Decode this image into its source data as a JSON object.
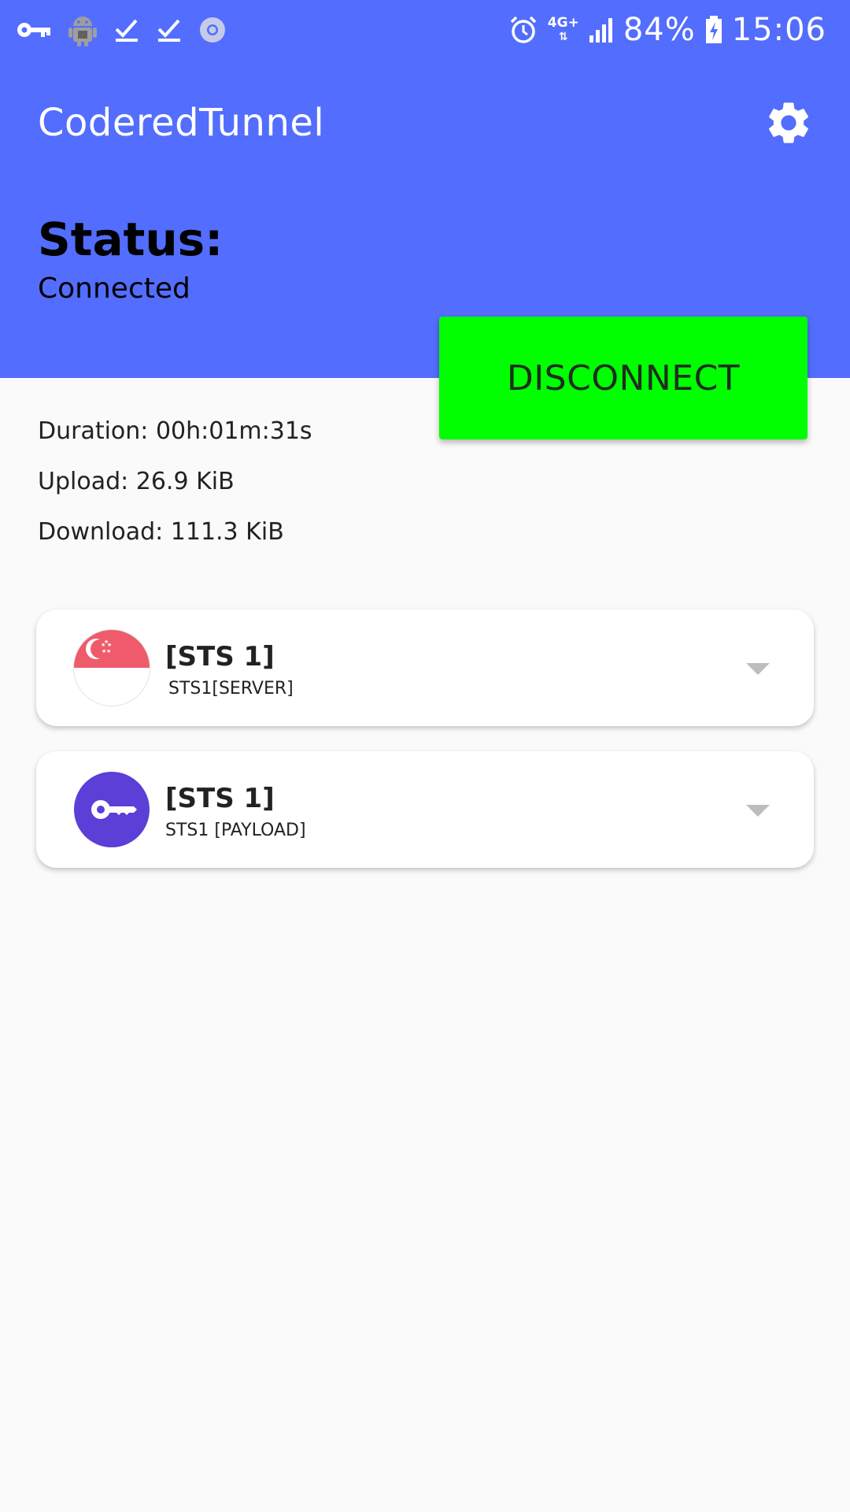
{
  "status_bar": {
    "left_icons": [
      "vpn-key-icon",
      "android-debug-icon",
      "checkmark-icon",
      "checkmark-icon",
      "chrome-icon"
    ],
    "network_type": "4G+",
    "battery_percent": "84%",
    "time": "15:06"
  },
  "app": {
    "title": "CoderedTunnel"
  },
  "status": {
    "label": "Status:",
    "value": "Connected"
  },
  "disconnect_button": {
    "label": "DISCONNECT"
  },
  "stats": {
    "duration": "Duration: 00h:01m:31s",
    "upload": "Upload: 26.9 KiB",
    "download": "Download: 111.3 KiB"
  },
  "server_card": {
    "title": "[STS 1]",
    "subtitle": "STS1[SERVER]",
    "icon": "singapore-flag-icon"
  },
  "payload_card": {
    "title": "[STS 1]",
    "subtitle": "STS1 [PAYLOAD]",
    "icon": "key-icon",
    "icon_color": "#5b3fd6"
  },
  "colors": {
    "header": "#536dfe",
    "disconnect": "#00ff00",
    "background": "#fafafa"
  }
}
